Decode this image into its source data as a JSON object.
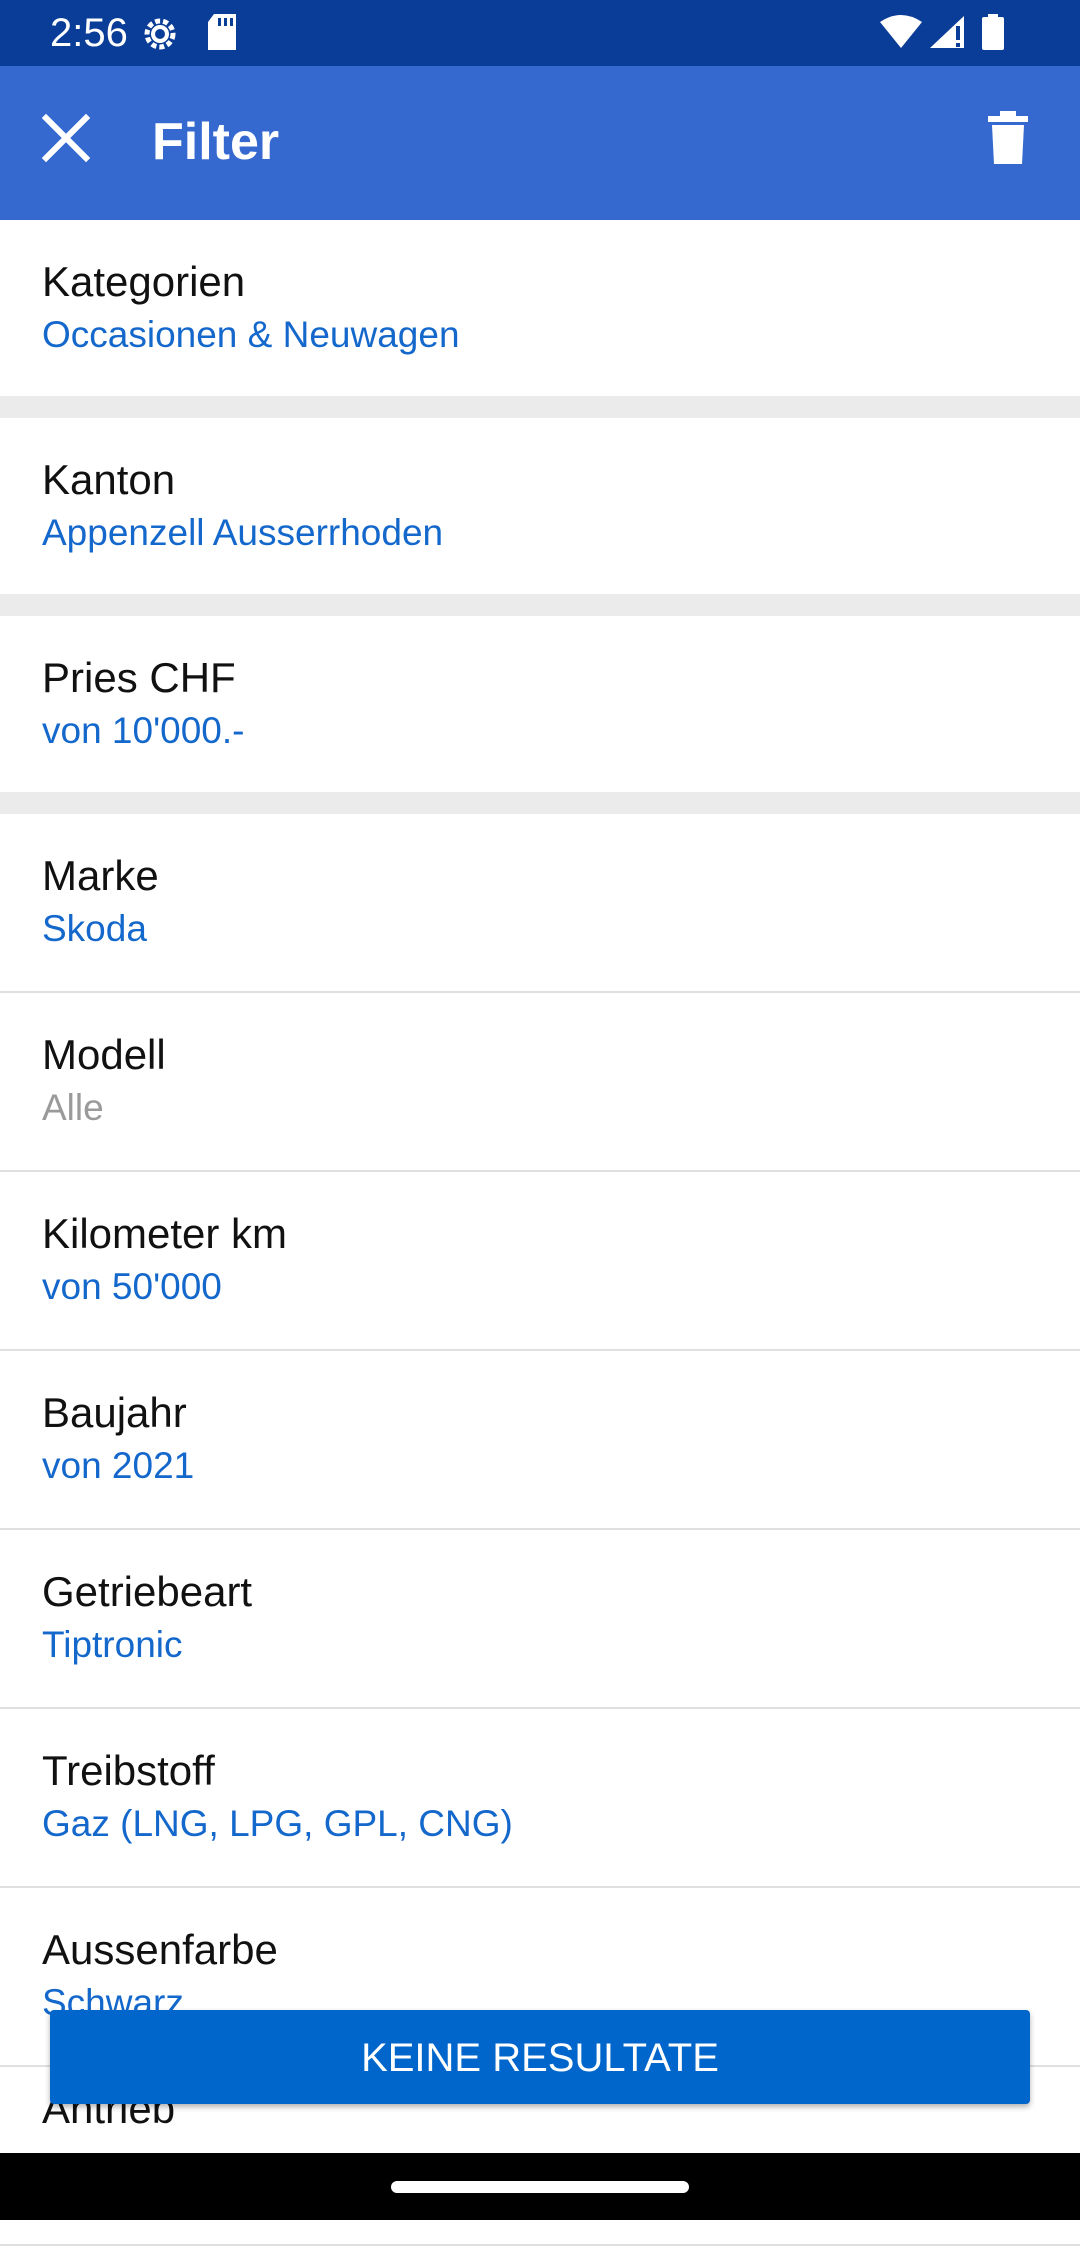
{
  "status": {
    "time": "2:56"
  },
  "app_bar": {
    "title": "Filter"
  },
  "filters": {
    "kategorien": {
      "label": "Kategorien",
      "value": "Occasionen & Neuwagen"
    },
    "kanton": {
      "label": "Kanton",
      "value": "Appenzell Ausserrhoden"
    },
    "preis": {
      "label": "Pries CHF",
      "value": "von 10'000.-"
    },
    "marke": {
      "label": "Marke",
      "value": "Skoda"
    },
    "modell": {
      "label": "Modell",
      "value": "Alle"
    },
    "kilometer": {
      "label": "Kilometer km",
      "value": "von 50'000"
    },
    "baujahr": {
      "label": "Baujahr",
      "value": "von 2021"
    },
    "getriebeart": {
      "label": "Getriebeart",
      "value": "Tiptronic"
    },
    "treibstoff": {
      "label": "Treibstoff",
      "value": "Gaz (LNG, LPG, GPL, CNG)"
    },
    "aussenfarbe": {
      "label": "Aussenfarbe",
      "value": "Schwarz"
    },
    "antrieb": {
      "label": "Antrieb"
    }
  },
  "footer": {
    "results_button": "KEINE RESULTATE"
  }
}
